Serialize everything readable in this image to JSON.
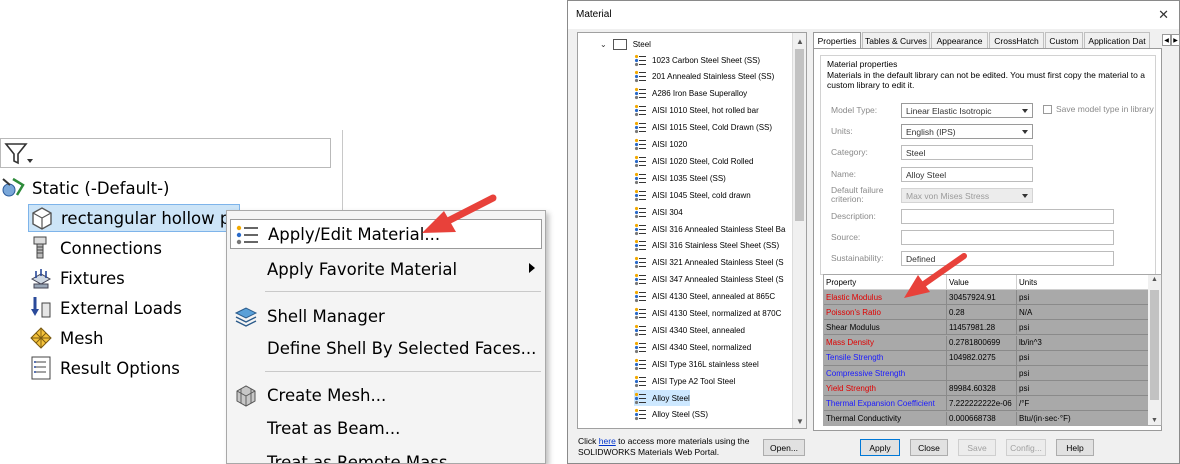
{
  "tree": {
    "root_label": "Static (-Default-)",
    "part_label": "rectangular hollow pla",
    "items": [
      "Connections",
      "Fixtures",
      "External Loads",
      "Mesh",
      "Result Options"
    ]
  },
  "context_menu": {
    "apply_edit_material": "Apply/Edit Material...",
    "apply_favorite_material": "Apply Favorite Material",
    "shell_manager": "Shell Manager",
    "define_shell": "Define Shell By Selected Faces...",
    "create_mesh": "Create Mesh...",
    "treat_as_beam": "Treat as Beam...",
    "treat_as_remote_mass": "Treat as Remote Mass"
  },
  "dialog": {
    "title": "Material",
    "close_glyph": "✕",
    "library": {
      "folder": "Steel",
      "items": [
        "1023 Carbon Steel Sheet (SS)",
        "201 Annealed Stainless Steel (SS)",
        "A286 Iron Base Superalloy",
        "AISI 1010 Steel, hot rolled bar",
        "AISI 1015 Steel, Cold Drawn (SS)",
        "AISI 1020",
        "AISI 1020 Steel, Cold Rolled",
        "AISI 1035 Steel (SS)",
        "AISI 1045 Steel, cold drawn",
        "AISI 304",
        "AISI 316 Annealed Stainless Steel Ba",
        "AISI 316 Stainless Steel Sheet (SS)",
        "AISI 321 Annealed Stainless Steel (S",
        "AISI 347 Annealed Stainless Steel (S",
        "AISI 4130 Steel, annealed at 865C",
        "AISI 4130 Steel, normalized at 870C",
        "AISI 4340 Steel, annealed",
        "AISI 4340 Steel, normalized",
        "AISI Type 316L stainless steel",
        "AISI Type A2 Tool Steel",
        "Alloy Steel",
        "Alloy Steel (SS)"
      ],
      "selected": "Alloy Steel"
    },
    "note_prefix": "Click ",
    "note_link": "here",
    "note_suffix": " to access more materials using the SOLIDWORKS Materials Web Portal.",
    "open_button": "Open...",
    "tabs": [
      "Properties",
      "Tables & Curves",
      "Appearance",
      "CrossHatch",
      "Custom",
      "Application Dat"
    ],
    "active_tab": "Properties",
    "props": {
      "group_title": "Material properties",
      "note": "Materials in the default library can not be edited. You must first copy the material to a custom library to edit it.",
      "model_type_label": "Model Type:",
      "model_type_value": "Linear Elastic Isotropic",
      "save_model_type": "Save model type in library",
      "units_label": "Units:",
      "units_value": "English (IPS)",
      "category_label": "Category:",
      "category_value": "Steel",
      "name_label": "Name:",
      "name_value": "Alloy Steel",
      "failure_label": "Default failure criterion:",
      "failure_value": "Max von Mises Stress",
      "description_label": "Description:",
      "description_value": "",
      "source_label": "Source:",
      "source_value": "",
      "sustainability_label": "Sustainability:",
      "sustainability_value": "Defined"
    },
    "table": {
      "headers": [
        "Property",
        "Value",
        "Units"
      ],
      "rows": [
        {
          "property": "Elastic Modulus",
          "value": "30457924.91",
          "units": "psi",
          "color": "#e00000"
        },
        {
          "property": "Poisson's Ratio",
          "value": "0.28",
          "units": "N/A",
          "color": "#e00000"
        },
        {
          "property": "Shear Modulus",
          "value": "11457981.28",
          "units": "psi",
          "color": "#000000"
        },
        {
          "property": "Mass Density",
          "value": "0.2781800699",
          "units": "lb/in^3",
          "color": "#e00000"
        },
        {
          "property": "Tensile Strength",
          "value": "104982.0275",
          "units": "psi",
          "color": "#1a1aff"
        },
        {
          "property": "Compressive Strength",
          "value": "",
          "units": "psi",
          "color": "#1a1aff"
        },
        {
          "property": "Yield Strength",
          "value": "89984.60328",
          "units": "psi",
          "color": "#e00000"
        },
        {
          "property": "Thermal Expansion Coefficient",
          "value": "7.222222222e-06",
          "units": "/°F",
          "color": "#1a1aff"
        },
        {
          "property": "Thermal Conductivity",
          "value": "0.000668738",
          "units": "Btu/(in·sec·°F)",
          "color": "#000000"
        }
      ]
    },
    "buttons": {
      "apply": "Apply",
      "close": "Close",
      "save": "Save",
      "config": "Config...",
      "help": "Help"
    }
  },
  "colors": {
    "arrow": "#e8413a",
    "selection": "#cce4f7"
  }
}
